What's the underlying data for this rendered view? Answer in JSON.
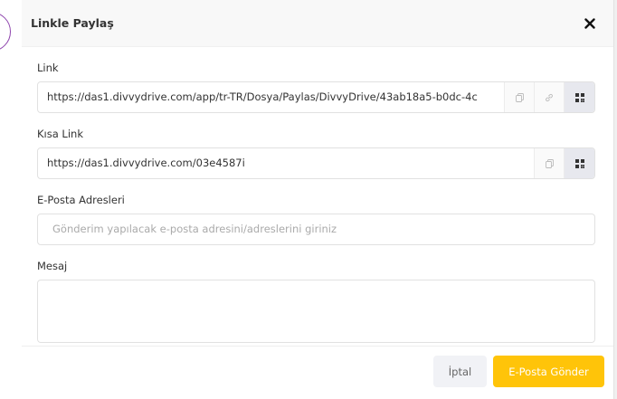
{
  "dialog": {
    "title": "Linkle Paylaş"
  },
  "link": {
    "label": "Link",
    "value": "https://das1.divvydrive.com/app/tr-TR/Dosya/Paylas/DivvyDrive/43ab18a5-b0dc-4c"
  },
  "short_link": {
    "label": "Kısa Link",
    "value": "https://das1.divvydrive.com/03e4587i"
  },
  "email": {
    "label": "E-Posta Adresleri",
    "placeholder": "Gönderim yapılacak e-posta adresini/adreslerini giriniz"
  },
  "message": {
    "label": "Mesaj",
    "value": ""
  },
  "footer": {
    "cancel_label": "İptal",
    "send_label": "E-Posta Gönder"
  },
  "icons": {
    "close": "close-icon",
    "copy": "copy-icon",
    "link": "link-icon",
    "qr": "qr-code-icon"
  },
  "colors": {
    "accent": "#ffc409",
    "cancel_bg": "#f1f2f6",
    "ring": "#8e44ad"
  }
}
